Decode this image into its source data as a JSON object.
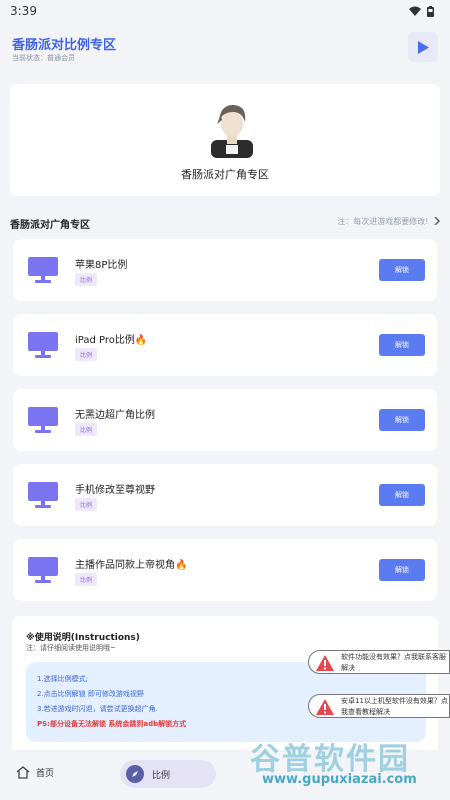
{
  "status_bar": {
    "time": "3:39"
  },
  "app_bar": {
    "title": "香肠派对比例专区",
    "subtitle": "当前状态：普通会员"
  },
  "hero": {
    "title": "香肠派对广角专区"
  },
  "section": {
    "title": "香肠派对广角专区",
    "note": "注：每次进游戏都要修改!"
  },
  "cards": [
    {
      "title": "苹果8P比例",
      "tag": "比例",
      "button": "解锁"
    },
    {
      "title": "iPad Pro比例🔥",
      "tag": "比例",
      "button": "解锁"
    },
    {
      "title": "无黑边超广角比例",
      "tag": "比例",
      "button": "解锁"
    },
    {
      "title": "手机修改至尊视野",
      "tag": "比例",
      "button": "解锁"
    },
    {
      "title": "主播作品同款上帝视角🔥",
      "tag": "比例",
      "button": "解锁"
    }
  ],
  "instructions": {
    "title": "※使用说明(Instructions)",
    "subtitle": "注：请仔细阅读使用说明哦~",
    "lines": [
      "1.选择比例模式;",
      "2.点击比例解锁 即可修改游戏视野",
      "3.若进游戏时闪退，请尝试更换超广角."
    ],
    "warning": "PS:部分设备无法解锁 系统会跳到adb解锁方式"
  },
  "bubbles": [
    {
      "text": "软件功能没有效果？点我联系客服解决"
    },
    {
      "text": "安卓11以上机型软件没有效果？点我查看教程解决"
    }
  ],
  "watermark": {
    "main": "谷普软件园",
    "url": "www.gupuxiazai.com"
  },
  "bottom_nav": {
    "home": "首页",
    "ratio": "比例"
  },
  "colors": {
    "accent": "#3f63e6",
    "button": "#5b7bf0",
    "monitor": "#7a74f0",
    "tag_bg": "#efe8fb"
  },
  "icons": [
    "wifi-icon",
    "battery-icon",
    "play-icon",
    "monitor-icon",
    "chevron-right-icon",
    "warning-icon",
    "home-icon",
    "compass-icon"
  ]
}
